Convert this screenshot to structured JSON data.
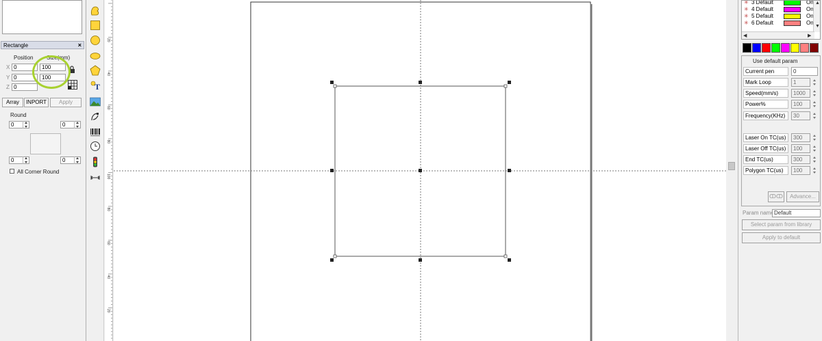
{
  "rect_panel": {
    "title": "Rectangle",
    "close_glyph": "×",
    "position_label": "Position",
    "size_label": "Size(mm)",
    "axis_x": "X",
    "axis_y": "Y",
    "axis_z": "Z",
    "pos_x": "0",
    "pos_y": "0",
    "pos_z": "0",
    "size_x": "100",
    "size_y": "100",
    "array_label": "Array",
    "inport_label": "INPORT",
    "apply_label": "Apply",
    "round_label": "Round",
    "round_tl": "0",
    "round_tr": "0",
    "round_bl": "0",
    "round_br": "0",
    "all_corner_label": "All Corner Round",
    "highlight_color": "#a8d130"
  },
  "tools": [
    {
      "name": "curve-tool-icon"
    },
    {
      "name": "rectangle-tool-icon"
    },
    {
      "name": "circle-tool-icon"
    },
    {
      "name": "ellipse-tool-icon"
    },
    {
      "name": "polygon-tool-icon"
    },
    {
      "name": "text-tool-icon"
    },
    {
      "name": "bitmap-tool-icon"
    },
    {
      "name": "vector-file-tool-icon"
    },
    {
      "name": "barcode-tool-icon"
    },
    {
      "name": "timer-tool-icon"
    },
    {
      "name": "io-signal-tool-icon"
    },
    {
      "name": "extend-axis-tool-icon"
    }
  ],
  "ruler_labels": [
    "0",
    "20",
    "40",
    "60",
    "80",
    "100",
    "80",
    "60",
    "40",
    "20",
    "0"
  ],
  "layers": [
    {
      "name": "3 Default",
      "color": "#00ff00",
      "state": "On"
    },
    {
      "name": "4 Default",
      "color": "#ff00ff",
      "state": "On"
    },
    {
      "name": "5 Default",
      "color": "#ffff00",
      "state": "On"
    },
    {
      "name": "6 Default",
      "color": "#ff8080",
      "state": "On"
    }
  ],
  "palette": [
    "#000000",
    "#0000ff",
    "#ff0000",
    "#00ff00",
    "#ff00ff",
    "#ffff00",
    "#ff8080",
    "#800000"
  ],
  "params": {
    "use_default_label": "Use default param",
    "check_glyph": "✓",
    "current_pen_label": "Current pen",
    "current_pen_value": "0",
    "mark_loop_label": "Mark Loop",
    "mark_loop_value": "1",
    "speed_label": "Speed(mm/s)",
    "speed_value": "1000",
    "power_label": "Power%",
    "power_value": "100",
    "frequency_label": "Frequency(KHz)",
    "frequency_value": "30",
    "laser_on_label": "Laser On TC(us)",
    "laser_on_value": "300",
    "laser_off_label": "Laser Off TC(us)",
    "laser_off_value": "100",
    "end_tc_label": "End TC(us)",
    "end_tc_value": "300",
    "polygon_tc_label": "Polygon TC(us)",
    "polygon_tc_value": "100",
    "lens_button_label": "ↀↀ",
    "advance_label": "Advance..."
  },
  "param_library": {
    "param_name_label": "Param name",
    "param_name_value": "Default",
    "select_label": "Select param from library",
    "apply_default_label": "Apply to default"
  }
}
